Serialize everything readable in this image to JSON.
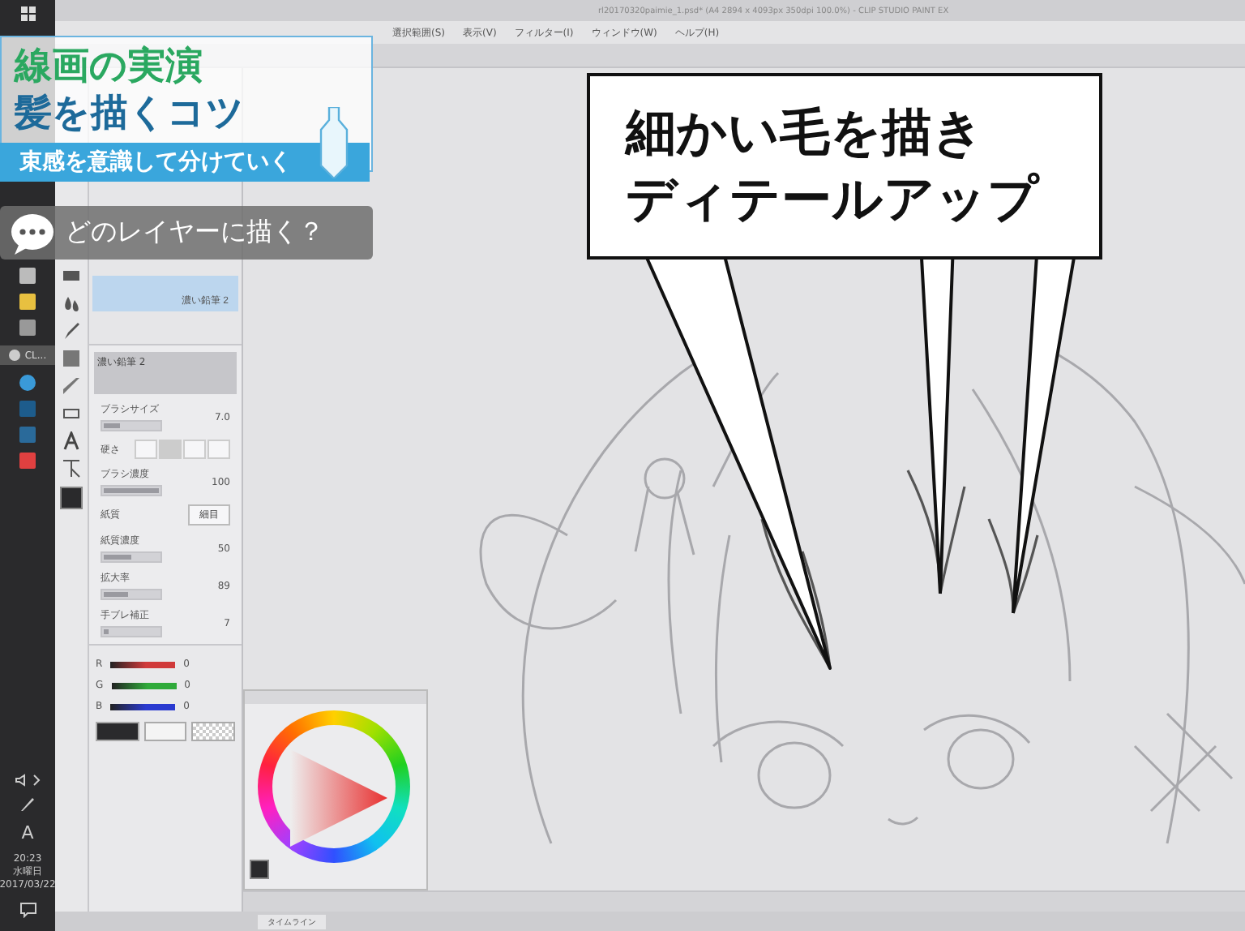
{
  "window": {
    "title": "rl20170320paimie_1.psd* (A4 2894 x 4093px 350dpi 100.0%) - CLIP STUDIO PAINT EX"
  },
  "menu": [
    "選択範囲(S)",
    "表示(V)",
    "フィルター(I)",
    "ウィンドウ(W)",
    "ヘルプ(H)"
  ],
  "taskbar": {
    "app_label": "CL...",
    "ime": "A",
    "clock": {
      "time": "20:23",
      "day": "水曜日",
      "date": "2017/03/22"
    }
  },
  "sub_tools": [
    {
      "name": "濃い鉛筆 2",
      "selected": true
    }
  ],
  "tool_property": {
    "brush": "濃い鉛筆 2",
    "rows": [
      {
        "kind": "slider",
        "label": "ブラシサイズ",
        "value": "7.0",
        "level": 0.3
      },
      {
        "kind": "steps",
        "label": "硬さ"
      },
      {
        "kind": "slider",
        "label": "ブラシ濃度",
        "value": "100",
        "level": 1
      },
      {
        "kind": "select",
        "label": "紙質",
        "value": "細目"
      },
      {
        "kind": "slider",
        "label": "紙質濃度",
        "value": "50",
        "level": 0.5
      },
      {
        "kind": "slider",
        "label": "拡大率",
        "value": "89",
        "level": 0.45
      },
      {
        "kind": "slider",
        "label": "手ブレ補正",
        "value": "7",
        "level": 0.1
      }
    ]
  },
  "color_sliders": [
    {
      "channel": "R",
      "value": "0",
      "color": "#d03a3a"
    },
    {
      "channel": "G",
      "value": "0",
      "color": "#2faa3a"
    },
    {
      "channel": "B",
      "value": "0",
      "color": "#2a3ad0"
    }
  ],
  "timeline_tab": "タイムライン",
  "overlay": {
    "title_lines": [
      "線画の実演",
      "髪を描くコツ"
    ],
    "subtitle": "束感を意識して分けていく",
    "question": "どのレイヤーに描く？"
  },
  "callout": {
    "lines": [
      "細かい毛を描き",
      "ディテールアップ"
    ]
  }
}
